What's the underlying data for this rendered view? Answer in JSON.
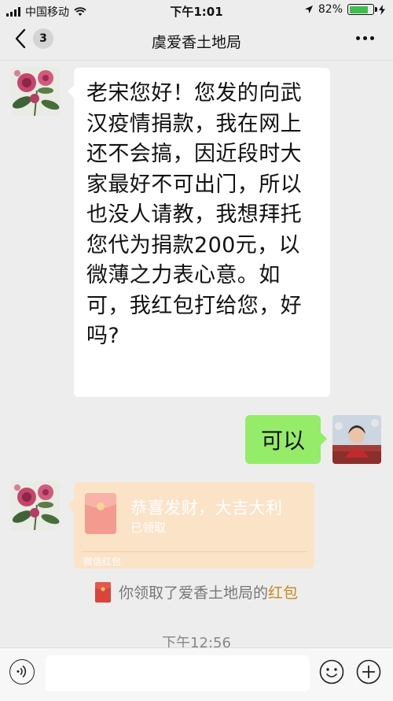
{
  "status_bar": {
    "carrier": "中国移动",
    "time": "下午1:01",
    "battery_percent": "82%",
    "battery_level": 0.82,
    "icons": [
      "signal-icon",
      "wifi-icon",
      "location-icon",
      "battery-icon",
      "charging-icon"
    ]
  },
  "nav": {
    "title": "虞爱香土地局",
    "unread_count": "3",
    "icons": [
      "back-chevron-icon",
      "more-icon"
    ]
  },
  "messages": {
    "incoming_text": "老宋您好！您发的向武汉疫情捐款，我在网上还不会搞，因近段时大家最好不可出门，所以也没人请教，我想拜托您代为捐款200元，以微薄之力表心意。如可，我红包打给您，好吗?",
    "outgoing_text": "可以",
    "red_packet": {
      "title": "恭喜发财，大吉大利",
      "status": "已领取",
      "footer": "微信红包"
    },
    "system_note": {
      "prefix": "你领取了爱香土地局的",
      "link": "红包"
    },
    "timestamp": "下午12:56"
  },
  "colors": {
    "chat_background": "#ededed",
    "outgoing_bubble": "#95ec69",
    "incoming_bubble": "#ffffff",
    "red_packet_background": "#fbe3c8",
    "red_packet_link": "#c88919"
  },
  "input_bar": {
    "icons": [
      "voice-icon",
      "emoji-icon",
      "plus-icon"
    ]
  }
}
